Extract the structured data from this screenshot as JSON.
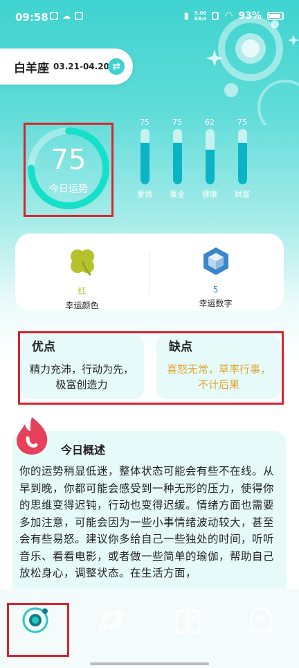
{
  "status_bar": {
    "time": "09:58",
    "net_speed_value": "5.00",
    "net_speed_unit": "KB/s",
    "battery": "93%"
  },
  "zodiac": {
    "name": "白羊座",
    "date_range": "03.21-04.20"
  },
  "score": {
    "value": "75",
    "label": "今日运势"
  },
  "categories": [
    {
      "label": "爱情",
      "value": 75
    },
    {
      "label": "事业",
      "value": 75
    },
    {
      "label": "健康",
      "value": 62
    },
    {
      "label": "财富",
      "value": 75
    }
  ],
  "lucky": {
    "color_value": "红",
    "color_label": "幸运颜色",
    "number_value": "5",
    "number_label": "幸运数字"
  },
  "pros": {
    "title": "优点",
    "line1": "精力充沛，行动为先，",
    "line2": "极富创造力"
  },
  "cons": {
    "title": "缺点",
    "line1": "喜怒无常，草率行事，",
    "line2": "不计后果"
  },
  "overview": {
    "title": "今日概述",
    "text": "你的运势稍显低迷，整体状态可能会有些不在线。从早到晚，你都可能会感受到一种无形的压力，使得你的思维变得迟钝，行动也变得迟缓。情绪方面也需要多加注意，可能会因为一些小事情绪波动较大，甚至会有些易怒。建议你多给自己一些独处的时间，听听音乐、看看电影，或者做一些简单的瑜伽，帮助自己放松身心，调整状态。在生活方面，"
  },
  "colors": {
    "accent": "#3fd3cf",
    "bar_fill": "#0ab4c4",
    "pros_text": "#222222",
    "cons_text": "#e0a630",
    "lucky_color_text": "#b5c22c",
    "lucky_number_text": "#3b86c8",
    "highlight_box": "#d9232e"
  },
  "nav": {
    "items": [
      {
        "icon": "planet-orbit-icon",
        "active": true
      },
      {
        "icon": "planet-ring-icon",
        "active": false
      },
      {
        "icon": "book-icon",
        "active": false
      },
      {
        "icon": "ghost-icon",
        "active": false
      }
    ]
  }
}
